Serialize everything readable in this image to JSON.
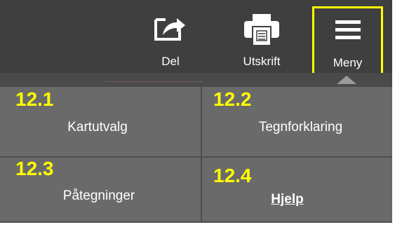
{
  "toolbar": {
    "share": {
      "label": "Del",
      "icon": "share-icon"
    },
    "print": {
      "label": "Utskrift",
      "icon": "printer-icon"
    },
    "menu": {
      "label": "Meny",
      "icon": "hamburger-menu-icon",
      "highlight_color": "#ffff00"
    }
  },
  "menu_items": [
    {
      "number": "12.1",
      "label": "Kartutvalg"
    },
    {
      "number": "12.2",
      "label": "Tegnforklaring"
    },
    {
      "number": "12.3",
      "label": "Påtegninger"
    },
    {
      "number": "12.4",
      "label": "Hjelp"
    }
  ],
  "colors": {
    "toolbar_bg": "#3f3f3f",
    "cell_bg": "#6a6a6a",
    "annotation": "#ffff00",
    "text": "#ffffff"
  }
}
